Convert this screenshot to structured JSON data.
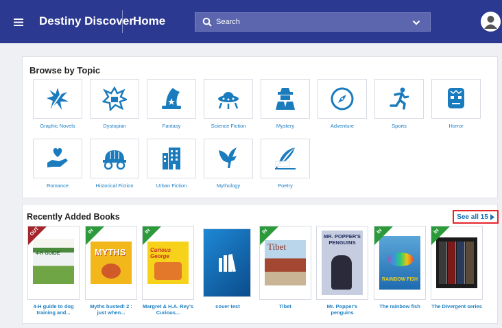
{
  "header": {
    "app_name": "Destiny Discover",
    "home_label": "Home",
    "search_placeholder": "Search",
    "icons": [
      "hamburger-menu-icon",
      "search-icon",
      "chevron-down-icon",
      "user-avatar-icon"
    ]
  },
  "browse": {
    "title": "Browse by Topic",
    "topics": [
      {
        "label": "Graphic Novels",
        "icon": "graphic-novels-icon"
      },
      {
        "label": "Dystopian",
        "icon": "dystopian-icon"
      },
      {
        "label": "Fantasy",
        "icon": "wizard-hat-icon"
      },
      {
        "label": "Science Fiction",
        "icon": "ufo-icon"
      },
      {
        "label": "Mystery",
        "icon": "detective-icon"
      },
      {
        "label": "Adventure",
        "icon": "compass-icon"
      },
      {
        "label": "Sports",
        "icon": "runner-icon"
      },
      {
        "label": "Horror",
        "icon": "monster-icon"
      },
      {
        "label": "Romance",
        "icon": "heart-hand-icon"
      },
      {
        "label": "Historical Fiction",
        "icon": "wagon-icon"
      },
      {
        "label": "Urban Fiction",
        "icon": "building-icon"
      },
      {
        "label": "Mythology",
        "icon": "pegasus-icon"
      },
      {
        "label": "Poetry",
        "icon": "quill-icon"
      }
    ]
  },
  "recent": {
    "title": "Recently Added Books",
    "see_all": "See all 15",
    "books": [
      {
        "badge": "OUT",
        "title": "4-H guide to dog training and...",
        "cover_text": "4-H GUIDE"
      },
      {
        "badge": "IN",
        "title": "Myths busted! 2 : just when...",
        "cover_text": "MYTHS"
      },
      {
        "badge": "IN",
        "title": "Margret & H.A. Rey's Curious...",
        "cover_text": "Curious George"
      },
      {
        "badge": "",
        "title": "cover test",
        "cover_text": ""
      },
      {
        "badge": "IN",
        "title": "Tibet",
        "cover_text": "Tibet"
      },
      {
        "badge": "",
        "title": "Mr. Popper's penguins",
        "cover_text": "MR. POPPER'S PENGUINS"
      },
      {
        "badge": "IN",
        "title": "The rainbow fish",
        "cover_text": "RAINBOW FISH"
      },
      {
        "badge": "IN",
        "title": "The Divergent series",
        "cover_text": ""
      }
    ]
  },
  "colors": {
    "header": "#2b3990",
    "link": "#1c7fc4",
    "icon": "#1a7bbd",
    "in_badge": "#2c9a3a",
    "out_badge": "#a4262c",
    "highlight": "#e3242b"
  }
}
